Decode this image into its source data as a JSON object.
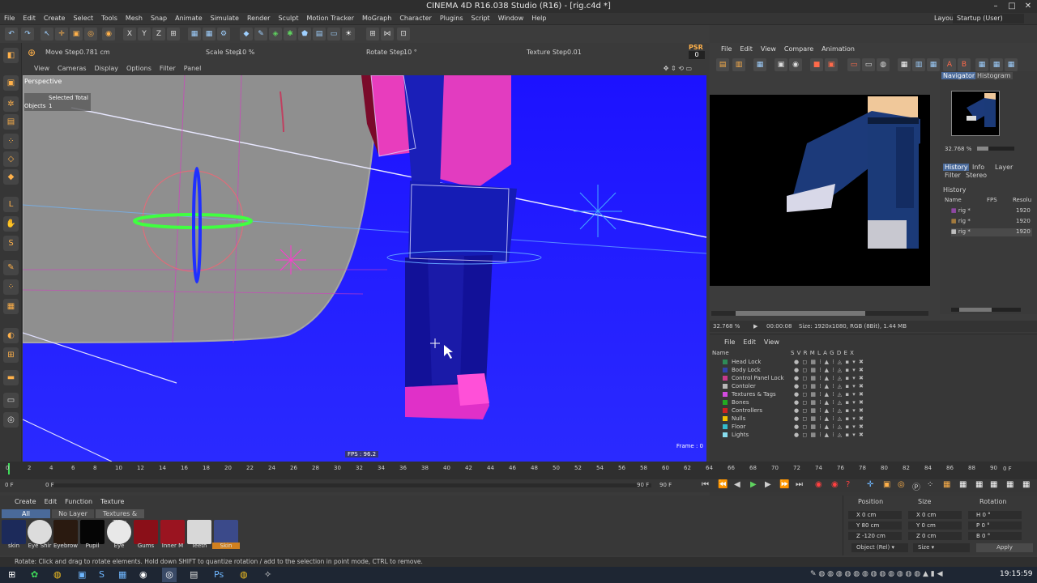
{
  "window": {
    "title": "CINEMA 4D R16.038 Studio (R16) - [rig.c4d *]",
    "layout_label": "Layout:",
    "layout_value": "Startup (User)"
  },
  "menu": [
    "File",
    "Edit",
    "Create",
    "Select",
    "Tools",
    "Mesh",
    "Snap",
    "Animate",
    "Simulate",
    "Render",
    "Sculpt",
    "Motion Tracker",
    "MoGraph",
    "Character",
    "Plugins",
    "Script",
    "Window",
    "Help"
  ],
  "steps": {
    "move_label": "Move Step",
    "move_value": "0.781 cm",
    "scale_label": "Scale Step",
    "scale_value": "10 %",
    "rotate_label": "Rotate Step",
    "rotate_value": "10 °",
    "texture_label": "Texture Step",
    "texture_value": "0.01",
    "psr": "PSR",
    "psr_value": "0"
  },
  "viewport": {
    "menu": [
      "View",
      "Cameras",
      "Display",
      "Options",
      "Filter",
      "Panel"
    ],
    "camera": "Perspective",
    "selected_total": "Selected Total",
    "objects_label": "Objects",
    "objects_count": "1",
    "fps": "FPS : 96.2",
    "frame": "Frame : 0"
  },
  "picture_viewer": {
    "menu": [
      "File",
      "Edit",
      "View",
      "Compare",
      "Animation"
    ],
    "zoom": "32.768 %",
    "time": "00:00:08",
    "size_info": "Size: 1920x1080, RGB (8Bit), 1.44 MB"
  },
  "navigator": {
    "tabs": [
      "Navigator",
      "Histogram"
    ],
    "zoom": "32.768 %",
    "history_tabs": [
      "History",
      "Info",
      "Layer"
    ],
    "history_tabs2": [
      "Filter",
      "Stereo"
    ],
    "history_title": "History",
    "columns": [
      "Name",
      "FPS",
      "Resolu"
    ],
    "rows": [
      {
        "name": "rig *",
        "res": "1920"
      },
      {
        "name": "rig *",
        "res": "1920"
      },
      {
        "name": "rig *",
        "res": "1920"
      }
    ]
  },
  "object_manager": {
    "menu": [
      "File",
      "Edit",
      "View"
    ],
    "columns": {
      "name": "Name",
      "flags": "S V R M L A G D E X"
    },
    "objects": [
      {
        "name": "Head Lock",
        "color": "#2e8b57"
      },
      {
        "name": "Body Lock",
        "color": "#3344aa"
      },
      {
        "name": "Control Panel Lock",
        "color": "#c83b8c"
      },
      {
        "name": "Contoler",
        "color": "#b8b8b8"
      },
      {
        "name": "Textures & Tags",
        "color": "#d24be0"
      },
      {
        "name": "Bones",
        "color": "#22aa22"
      },
      {
        "name": "Controllers",
        "color": "#cc2222"
      },
      {
        "name": "Nulls",
        "color": "#f0c000"
      },
      {
        "name": "Floor",
        "color": "#33bbcc"
      },
      {
        "name": "Lights",
        "color": "#88ddee"
      }
    ]
  },
  "timeline": {
    "ticks": [
      "0",
      "2",
      "4",
      "6",
      "8",
      "10",
      "12",
      "14",
      "16",
      "18",
      "20",
      "22",
      "24",
      "26",
      "28",
      "30",
      "32",
      "34",
      "36",
      "38",
      "40",
      "42",
      "44",
      "46",
      "48",
      "50",
      "52",
      "54",
      "56",
      "58",
      "60",
      "62",
      "64",
      "66",
      "68",
      "70",
      "72",
      "74",
      "76",
      "78",
      "80",
      "82",
      "84",
      "86",
      "88",
      "90"
    ],
    "end_label": "0 F",
    "current": "0 F",
    "start": "0 F",
    "end": "90 F",
    "end2": "90 F"
  },
  "materials": {
    "menu": [
      "Create",
      "Edit",
      "Function",
      "Texture"
    ],
    "filters": [
      "All",
      "No Layer",
      "Textures & Tags"
    ],
    "items": [
      {
        "label": "skin",
        "color": "#1c2a5a"
      },
      {
        "label": "Eye Shir",
        "color": "#dcdcdc"
      },
      {
        "label": "Eyebrow",
        "color": "#2a1a10"
      },
      {
        "label": "Pupil",
        "color": "#050505"
      },
      {
        "label": "Eye",
        "color": "#e8e8e8"
      },
      {
        "label": "Gums",
        "color": "#8a0f18"
      },
      {
        "label": "Inner M",
        "color": "#9a1420"
      },
      {
        "label": "Teeth",
        "color": "#d8d8d8"
      },
      {
        "label": "Skin",
        "color": "#3b4a8a"
      }
    ]
  },
  "coordinates": {
    "position": "Position",
    "size": "Size",
    "rotation": "Rotation",
    "rows": [
      {
        "axis": "X",
        "pos": "0 cm",
        "size_axis": "X",
        "size": "0 cm",
        "rot_axis": "H",
        "rot": "0 °"
      },
      {
        "axis": "Y",
        "pos": "80 cm",
        "size_axis": "Y",
        "size": "0 cm",
        "rot_axis": "P",
        "rot": "0 °"
      },
      {
        "axis": "Z",
        "pos": "-120 cm",
        "size_axis": "Z",
        "size": "0 cm",
        "rot_axis": "B",
        "rot": "0 °"
      }
    ],
    "mode": "Object (Rel)",
    "size_mode": "Size",
    "apply": "Apply"
  },
  "status": "Rotate: Click and drag to rotate elements. Hold down SHIFT to quantize rotation / add to the selection in point mode, CTRL to remove.",
  "taskbar": {
    "clock": "19:15:59"
  }
}
